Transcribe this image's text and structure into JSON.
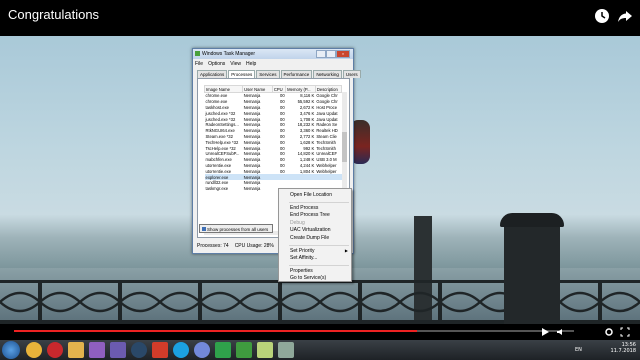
{
  "player": {
    "title": "Congratulations",
    "progress": 0.72,
    "colors": {
      "progress": "#e22222"
    },
    "icons": [
      "clock-icon",
      "share-icon",
      "play-icon",
      "skip-icon",
      "volume-icon",
      "settings-icon",
      "fullscreen-icon"
    ]
  },
  "task_manager": {
    "title": "Windows Task Manager",
    "menu": [
      "File",
      "Options",
      "View",
      "Help"
    ],
    "tabs": [
      "Applications",
      "Processes",
      "Services",
      "Performance",
      "Networking",
      "Users"
    ],
    "active_tab": "Processes",
    "columns": [
      "Image Name",
      "User Name",
      "CPU",
      "Memory (P...",
      "Description"
    ],
    "rows": [
      [
        "chrome.exe",
        "Nemanja",
        "00",
        "8,116 K",
        "Google Chr"
      ],
      [
        "chrome.exe",
        "Nemanja",
        "00",
        "55,592 K",
        "Google Chr"
      ],
      [
        "taskhost.exe",
        "Nemanja",
        "00",
        "2,672 K",
        "Host Proce"
      ],
      [
        "jusched.exe *32",
        "Nemanja",
        "00",
        "3,476 K",
        "Java Updat"
      ],
      [
        "jusched.exe *32",
        "Nemanja",
        "00",
        "1,708 K",
        "Java Updat"
      ],
      [
        "RadeonSettings...",
        "Nemanja",
        "00",
        "18,232 K",
        "Radeon Se"
      ],
      [
        "RtkNGUI64.exe",
        "Nemanja",
        "00",
        "3,360 K",
        "Realtek HD"
      ],
      [
        "Steam.exe *32",
        "Nemanja",
        "00",
        "2,772 K",
        "Steam Clie"
      ],
      [
        "TechHelp.exe *32",
        "Nemanja",
        "00",
        "1,628 K",
        "TechSmith"
      ],
      [
        "TscHelp.exe *32",
        "Nemanja",
        "00",
        "992 K",
        "TechSmith"
      ],
      [
        "UnrealCEFSubP...",
        "Nemanja",
        "00",
        "14,820 K",
        "UnrealCEF"
      ],
      [
        "mabchfen.exe",
        "Nemanja",
        "00",
        "1,248 K",
        "USB 3.0 M"
      ],
      [
        "utorrentie.exe",
        "Nemanja",
        "00",
        "4,244 K",
        "Webhelper"
      ],
      [
        "utorrentie.exe",
        "Nemanja",
        "00",
        "1,804 K",
        "Webhelper"
      ],
      [
        "explorer.exe",
        "Nemanja",
        "",
        "",
        ""
      ],
      [
        "rundll32.exe",
        "Nemanja",
        "",
        "",
        ""
      ],
      [
        "taskmgr.exe",
        "Nemanja",
        "",
        "",
        ""
      ]
    ],
    "selected_row": 14,
    "show_all_label": "Show processes from all users",
    "status_processes": "Processes: 74",
    "status_cpu": "CPU Usage: 28%"
  },
  "context_menu": {
    "items": [
      {
        "label": "Open File Location",
        "disabled": false
      },
      {
        "sep": true
      },
      {
        "label": "End Process",
        "disabled": false
      },
      {
        "label": "End Process Tree",
        "disabled": false
      },
      {
        "label": "Debug",
        "disabled": true
      },
      {
        "label": "UAC Virtualization",
        "disabled": false
      },
      {
        "label": "Create Dump File",
        "disabled": false
      },
      {
        "sep": true
      },
      {
        "label": "Set Priority",
        "disabled": false,
        "submenu": true
      },
      {
        "label": "Set Affinity...",
        "disabled": false
      },
      {
        "sep": true
      },
      {
        "label": "Properties",
        "disabled": false
      },
      {
        "label": "Go to Service(s)",
        "disabled": false
      }
    ]
  },
  "taskbar": {
    "app_icons": [
      "chrome-icon",
      "opera-icon",
      "explorer-icon",
      "media-player-icon",
      "visual-studio-icon",
      "steam-icon",
      "record-icon",
      "skype-icon",
      "discord-icon",
      "camtasia-icon",
      "video-editor-icon",
      "notes-icon",
      "task-manager-icon"
    ],
    "language": "EN",
    "time": "13:56",
    "date": "11.7.2018"
  }
}
